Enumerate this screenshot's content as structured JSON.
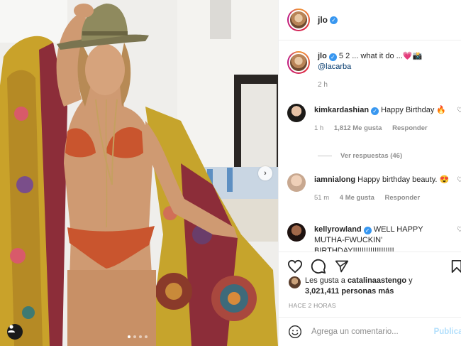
{
  "post": {
    "username": "jlo",
    "caption": "5 2 ... what it do ...💗📸",
    "mention": "@lacarba",
    "time": "2 h"
  },
  "comments": [
    {
      "user": "kimkardashian",
      "text": "Happy Birthday 🔥",
      "time": "1 h",
      "likes": "1,812 Me gusta",
      "reply": "Responder"
    },
    {
      "user": "iamnialong",
      "text": "Happy birthday beauty. 😍",
      "time": "51 m",
      "likes": "4 Me gusta",
      "reply": "Responder"
    },
    {
      "user": "kellyrowland",
      "text": "WELL HAPPY MUTHA-FWUCKIN' BIRTHDAY!!!!!!!!!!!!!!!!!!!",
      "time": "",
      "likes": "",
      "reply": ""
    }
  ],
  "view_replies": "Ver respuestas (46)",
  "likes": {
    "prefix": "Les gusta a",
    "liker": "catalinaastengo",
    "conj": "y",
    "count": "3,021,411 personas más"
  },
  "posted_ago": "HACE 2 HORAS",
  "composer": {
    "placeholder": "Agrega un comentario...",
    "publish": "Publicar"
  },
  "colors": {
    "verified": "#3897f0",
    "muted": "#8e8e8e",
    "link": "#00376b"
  },
  "carousel": {
    "total_dots": 4,
    "active_dot": 1
  }
}
